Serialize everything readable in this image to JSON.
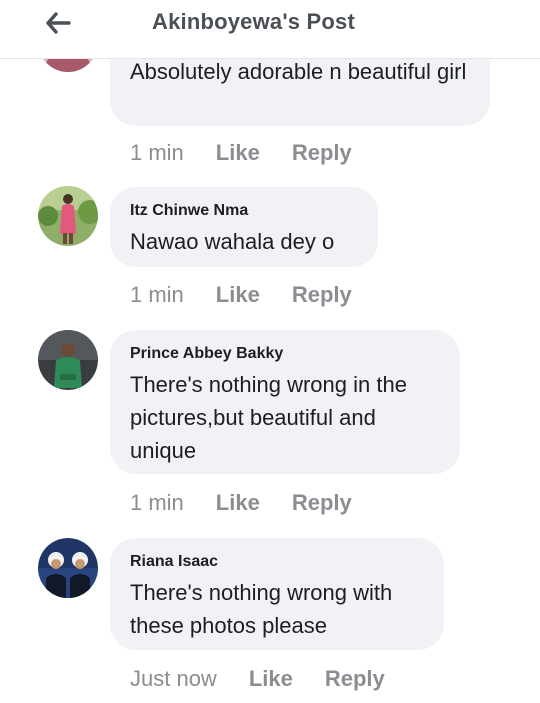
{
  "header": {
    "title": "Akinboyewa's Post",
    "back_icon": "back-arrow-icon"
  },
  "comments": [
    {
      "author": "",
      "text": "Absolutely adorable n beautiful girl",
      "time": "1 min",
      "like_label": "Like",
      "reply_label": "Reply"
    },
    {
      "author": "Itz Chinwe Nma",
      "text": "Nawao wahala dey o",
      "time": "1 min",
      "like_label": "Like",
      "reply_label": "Reply"
    },
    {
      "author": "Prince Abbey Bakky",
      "text": "There's nothing wrong in the pictures,but beautiful and unique",
      "time": "1 min",
      "like_label": "Like",
      "reply_label": "Reply"
    },
    {
      "author": "Riana Isaac",
      "text": "There's nothing wrong with these photos please",
      "time": "Just now",
      "like_label": "Like",
      "reply_label": "Reply"
    }
  ],
  "colors": {
    "bubble": "#f0f2f5",
    "muted": "#8a8d91",
    "title": "#4b4f56"
  }
}
